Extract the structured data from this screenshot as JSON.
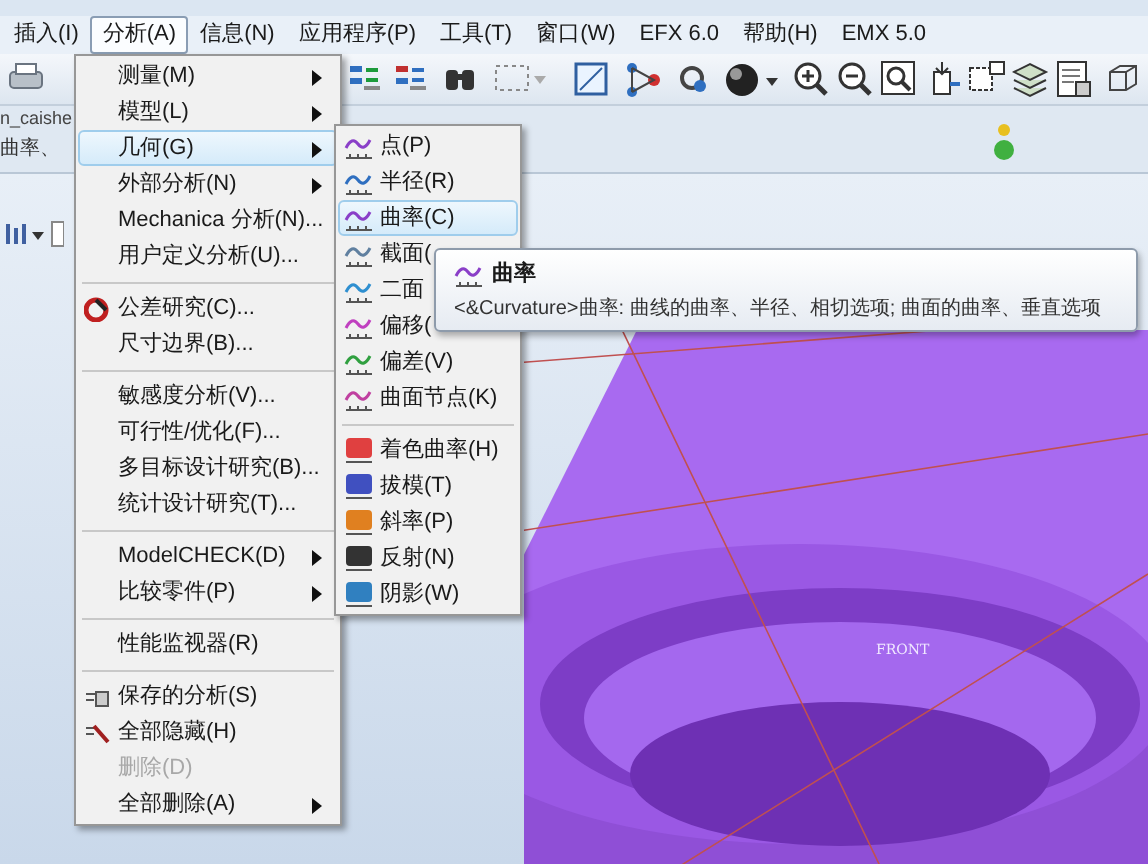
{
  "menu_bar": [
    {
      "label": "插入(I)",
      "selected": false
    },
    {
      "label": "分析(A)",
      "selected": true
    },
    {
      "label": "信息(N)",
      "selected": false
    },
    {
      "label": "应用程序(P)",
      "selected": false
    },
    {
      "label": "工具(T)",
      "selected": false
    },
    {
      "label": "窗口(W)",
      "selected": false
    },
    {
      "label": "EFX 6.0",
      "selected": false
    },
    {
      "label": "帮助(H)",
      "selected": false
    },
    {
      "label": "EMX 5.0",
      "selected": false
    }
  ],
  "status_texts": [
    "n_caishe",
    "曲率、"
  ],
  "analysis_menu": [
    {
      "kind": "item",
      "label": "测量(M)",
      "submenu": true,
      "selected": false,
      "disabled": false
    },
    {
      "kind": "item",
      "label": "模型(L)",
      "submenu": true,
      "selected": false,
      "disabled": false
    },
    {
      "kind": "item",
      "label": "几何(G)",
      "submenu": true,
      "selected": true,
      "disabled": false
    },
    {
      "kind": "item",
      "label": "外部分析(N)",
      "submenu": true,
      "selected": false,
      "disabled": false
    },
    {
      "kind": "item",
      "label": "Mechanica 分析(N)...",
      "submenu": false,
      "selected": false,
      "disabled": false
    },
    {
      "kind": "item",
      "label": "用户定义分析(U)...",
      "submenu": false,
      "selected": false,
      "disabled": false
    },
    {
      "kind": "separator"
    },
    {
      "kind": "item",
      "label": "公差研究(C)...",
      "submenu": false,
      "selected": false,
      "disabled": false
    },
    {
      "kind": "item",
      "label": "尺寸边界(B)...",
      "submenu": false,
      "selected": false,
      "disabled": false
    },
    {
      "kind": "separator"
    },
    {
      "kind": "item",
      "label": "敏感度分析(V)...",
      "submenu": false,
      "selected": false,
      "disabled": false
    },
    {
      "kind": "item",
      "label": "可行性/优化(F)...",
      "submenu": false,
      "selected": false,
      "disabled": false
    },
    {
      "kind": "item",
      "label": "多目标设计研究(B)...",
      "submenu": false,
      "selected": false,
      "disabled": false
    },
    {
      "kind": "item",
      "label": "统计设计研究(T)...",
      "submenu": false,
      "selected": false,
      "disabled": false
    },
    {
      "kind": "separator"
    },
    {
      "kind": "item",
      "label": "ModelCHECK(D)",
      "submenu": true,
      "selected": false,
      "disabled": false
    },
    {
      "kind": "item",
      "label": "比较零件(P)",
      "submenu": true,
      "selected": false,
      "disabled": false
    },
    {
      "kind": "separator"
    },
    {
      "kind": "item",
      "label": "性能监视器(R)",
      "submenu": false,
      "selected": false,
      "disabled": false
    },
    {
      "kind": "separator"
    },
    {
      "kind": "item",
      "label": "保存的分析(S)",
      "submenu": false,
      "selected": false,
      "disabled": false
    },
    {
      "kind": "item",
      "label": "全部隐藏(H)",
      "submenu": false,
      "selected": false,
      "disabled": false
    },
    {
      "kind": "item",
      "label": "删除(D)",
      "submenu": false,
      "selected": false,
      "disabled": true
    },
    {
      "kind": "item",
      "label": "全部删除(A)",
      "submenu": true,
      "selected": false,
      "disabled": false
    }
  ],
  "geometry_menu": [
    {
      "kind": "item",
      "label": "点(P)",
      "selected": false
    },
    {
      "kind": "item",
      "label": "半径(R)",
      "selected": false
    },
    {
      "kind": "item",
      "label": "曲率(C)",
      "selected": true
    },
    {
      "kind": "item",
      "label": "截面(",
      "selected": false
    },
    {
      "kind": "item",
      "label": "二面",
      "selected": false
    },
    {
      "kind": "item",
      "label": "偏移(",
      "selected": false
    },
    {
      "kind": "item",
      "label": "偏差(V)",
      "selected": false
    },
    {
      "kind": "item",
      "label": "曲面节点(K)",
      "selected": false
    },
    {
      "kind": "separator"
    },
    {
      "kind": "item",
      "label": "着色曲率(H)",
      "selected": false
    },
    {
      "kind": "item",
      "label": "拔模(T)",
      "selected": false
    },
    {
      "kind": "item",
      "label": "斜率(P)",
      "selected": false
    },
    {
      "kind": "item",
      "label": "反射(N)",
      "selected": false
    },
    {
      "kind": "item",
      "label": "阴影(W)",
      "selected": false
    }
  ],
  "tooltip": {
    "title": "曲率",
    "description": "<&Curvature>曲率: 曲线的曲率、半径、相切选项; 曲面的曲率、垂直选项"
  },
  "viewport": {
    "datum_label": "FRONT"
  }
}
